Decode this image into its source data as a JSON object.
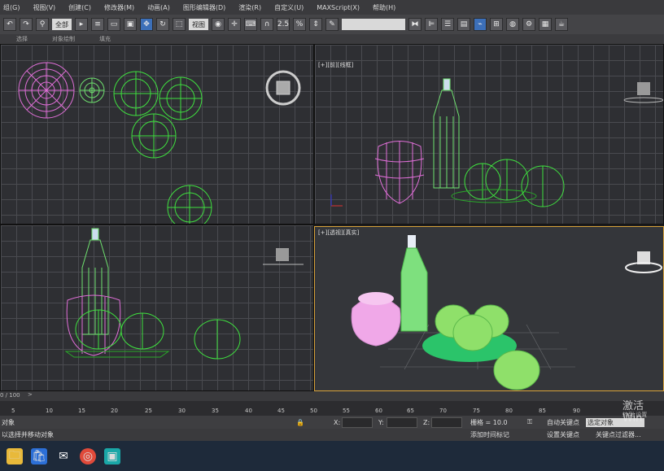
{
  "menus": [
    "组(G)",
    "视图(V)",
    "创建(C)",
    "修改器(M)",
    "动画(A)",
    "图形编辑器(D)",
    "渲染(R)",
    "自定义(U)",
    "MAXScript(X)",
    "帮助(H)"
  ],
  "toolbar": {
    "selection_filter": "全部",
    "view_dropdown": "视图",
    "angle_snap_label": "2.5",
    "percent_snap_label": "%"
  },
  "ribbon": {
    "items": [
      "选择",
      "对象绘制",
      "填充"
    ]
  },
  "viewports": {
    "top": {
      "label": ""
    },
    "front": {
      "label": "[+][前][线框]"
    },
    "left": {
      "label": ""
    },
    "perspective": {
      "label": "[+][透视][真实]"
    }
  },
  "timeline": {
    "frame_display": "0 / 100",
    "next_arrow": ">",
    "ticks": [
      "5",
      "10",
      "15",
      "20",
      "25",
      "30",
      "35",
      "40",
      "45",
      "50",
      "55",
      "60",
      "65",
      "70",
      "75",
      "80",
      "85",
      "90"
    ]
  },
  "status": {
    "selection": "对象",
    "prompt": "以选择并移动对象",
    "x_label": "X:",
    "y_label": "Y:",
    "z_label": "Z:",
    "grid": "栅格 = 10.0",
    "auto_key": "自动关键点",
    "selected_object": "选定对象",
    "set_key": "设置关键点",
    "key_filters": "关键点过滤器...",
    "add_time_tag": "添加时间标记"
  },
  "watermark": {
    "line1": "激活 Win",
    "line2": "转到 设置"
  }
}
